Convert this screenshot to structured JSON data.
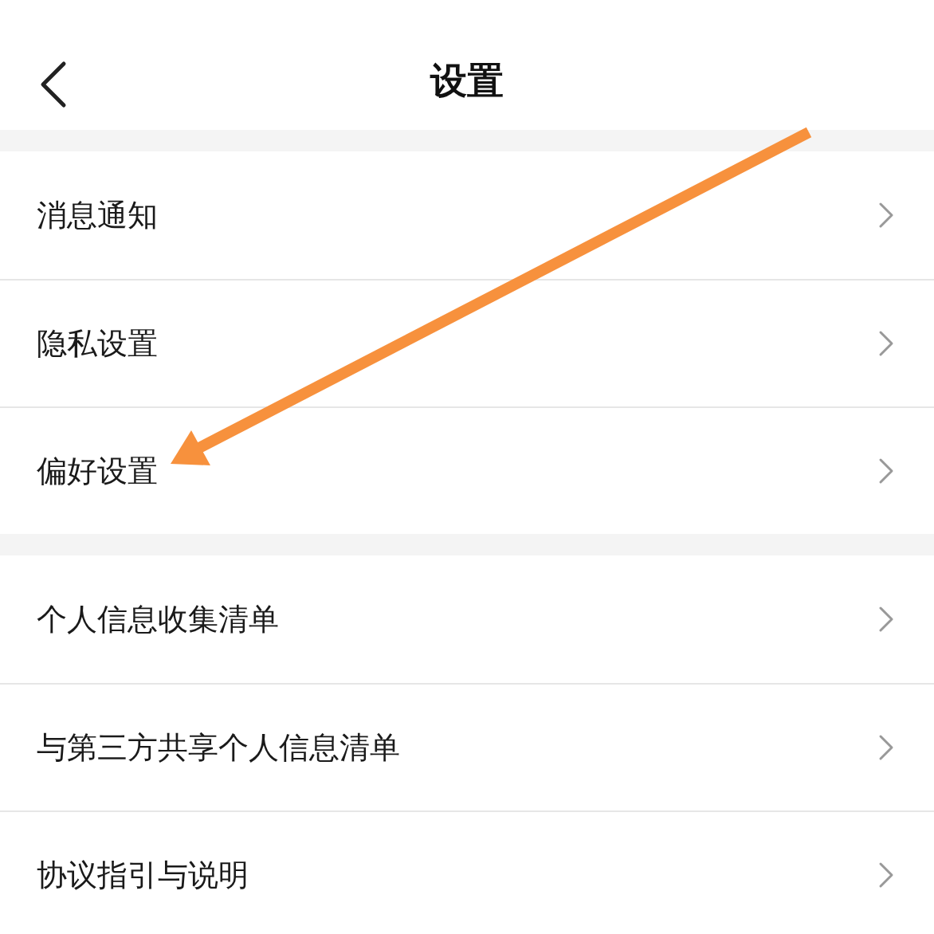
{
  "header": {
    "title": "设置"
  },
  "groups": [
    {
      "items": [
        {
          "label": "消息通知"
        },
        {
          "label": "隐私设置"
        },
        {
          "label": "偏好设置"
        }
      ]
    },
    {
      "items": [
        {
          "label": "个人信息收集清单"
        },
        {
          "label": "与第三方共享个人信息清单"
        },
        {
          "label": "协议指引与说明"
        }
      ]
    }
  ]
}
